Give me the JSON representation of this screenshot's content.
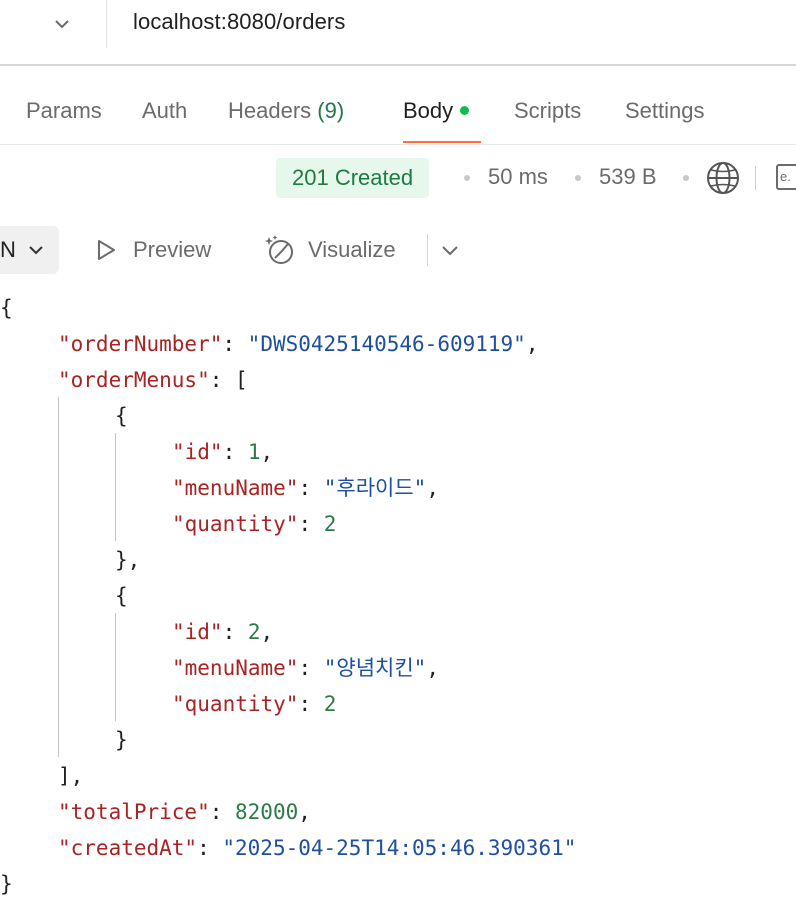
{
  "request": {
    "url": "localhost:8080/orders"
  },
  "tabs": {
    "params": "Params",
    "auth": "Auth",
    "headers": "Headers",
    "headers_count": "(9)",
    "body": "Body",
    "scripts": "Scripts",
    "settings": "Settings",
    "active": "Body",
    "accent": "#ff6c37"
  },
  "response": {
    "status": "201 Created",
    "time": "50 ms",
    "size": "539 B",
    "status_color": "#1f7a44"
  },
  "viewer": {
    "format_fragment": "N",
    "preview_label": "Preview",
    "visualize_label": "Visualize"
  },
  "json": {
    "open_brace": "{",
    "close_brace": "}",
    "order_number_key": "\"orderNumber\"",
    "order_number_value": "\"DWS0425140546-609119\"",
    "order_menus_key": "\"orderMenus\"",
    "menus_open": "[",
    "menus_close": "],",
    "items": [
      {
        "open": "{",
        "id_key": "\"id\"",
        "id_value": "1",
        "menu_name_key": "\"menuName\"",
        "menu_name_value": "\"후라이드\"",
        "quantity_key": "\"quantity\"",
        "quantity_value": "2",
        "close": "},"
      },
      {
        "open": "{",
        "id_key": "\"id\"",
        "id_value": "2",
        "menu_name_key": "\"menuName\"",
        "menu_name_value": "\"양념치킨\"",
        "quantity_key": "\"quantity\"",
        "quantity_value": "2",
        "close": "}"
      }
    ],
    "total_price_key": "\"totalPrice\"",
    "total_price_value": "82000",
    "created_at_key": "\"createdAt\"",
    "created_at_value": "\"2025-04-25T14:05:46.390361\""
  }
}
